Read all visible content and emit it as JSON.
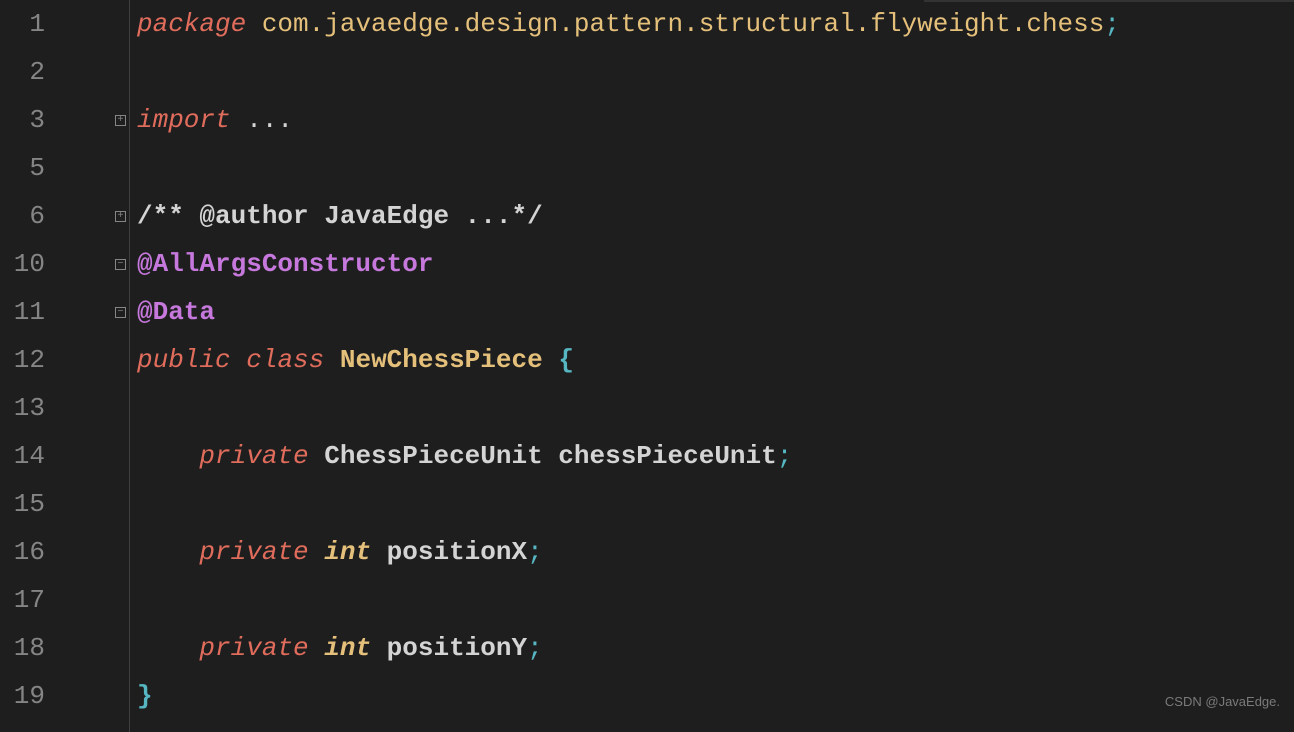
{
  "gutter": {
    "lines": [
      "1",
      "2",
      "3",
      "5",
      "6",
      "10",
      "11",
      "12",
      "13",
      "14",
      "15",
      "16",
      "17",
      "18",
      "19"
    ]
  },
  "code": {
    "line1": {
      "kw": "package",
      "pkg": "com.javaedge.design.pattern.structural.flyweight.chess",
      "semi": ";"
    },
    "line3": {
      "kw": "import",
      "rest": " ..."
    },
    "line6": {
      "comment": "/** @author JavaEdge ...*/"
    },
    "line10": {
      "annotation": "@AllArgsConstructor"
    },
    "line11": {
      "annotation": "@Data"
    },
    "line12": {
      "kw1": "public",
      "kw2": "class",
      "name": "NewChessPiece",
      "brace": "{"
    },
    "line14": {
      "kw": "private",
      "type": "ChessPieceUnit",
      "field": "chessPieceUnit",
      "semi": ";"
    },
    "line16": {
      "kw": "private",
      "type": "int",
      "field": "positionX",
      "semi": ";"
    },
    "line18": {
      "kw": "private",
      "type": "int",
      "field": "positionY",
      "semi": ";"
    },
    "line19": {
      "brace": "}"
    }
  },
  "watermark": "CSDN @JavaEdge."
}
